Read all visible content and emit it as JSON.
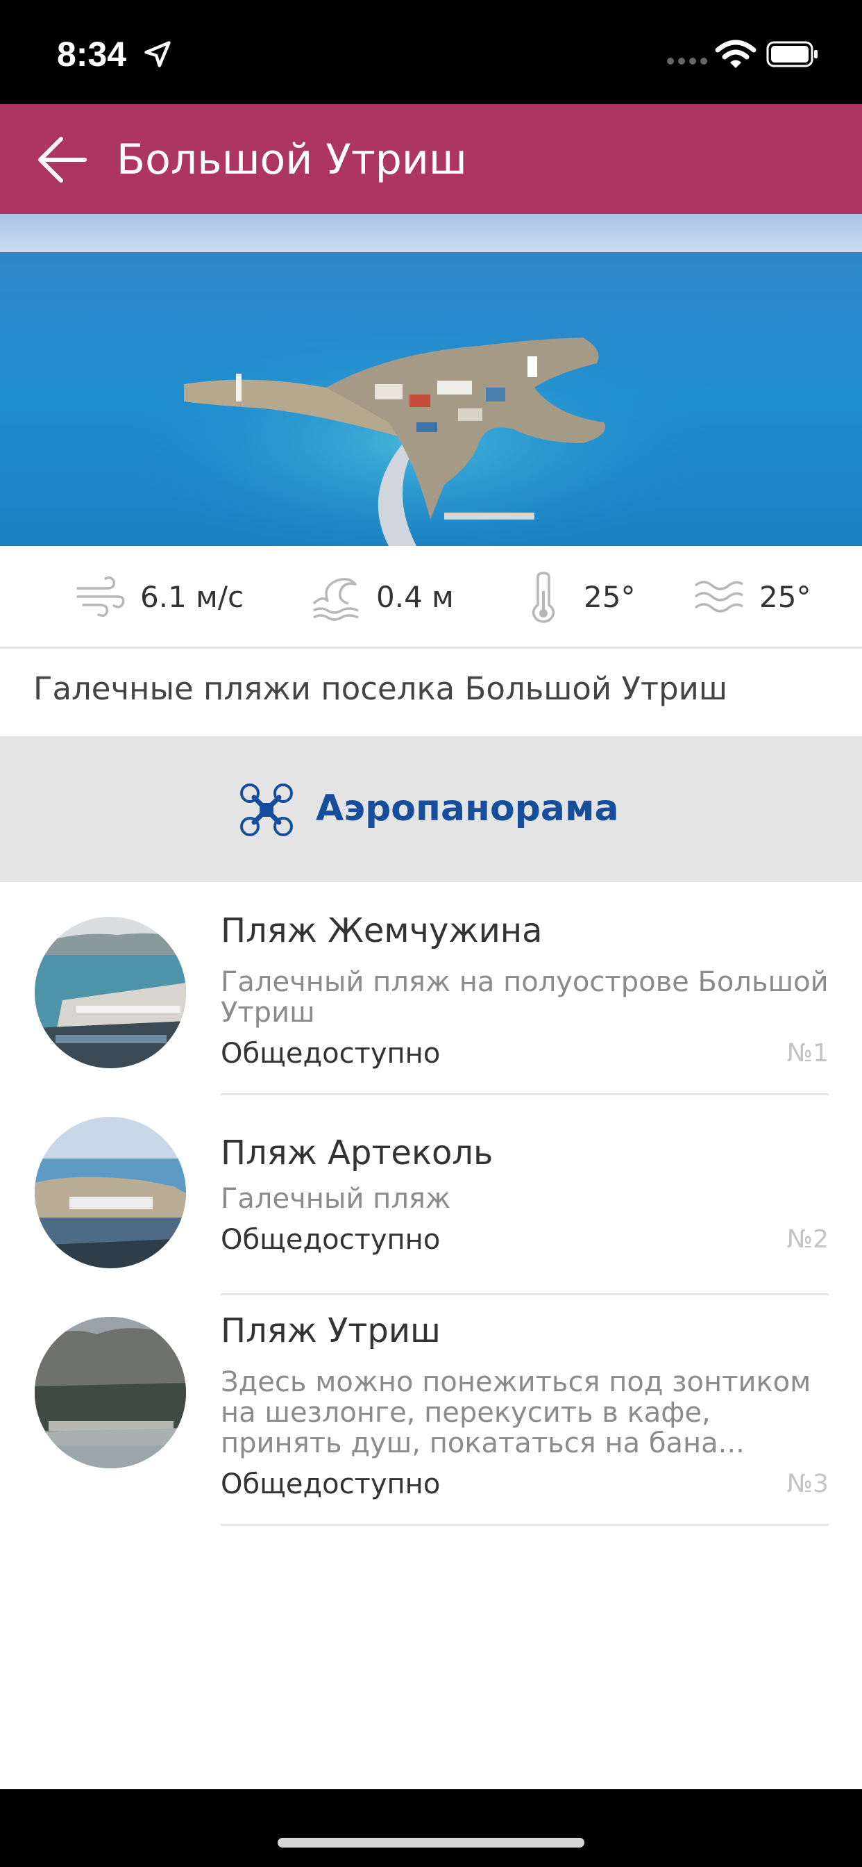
{
  "status": {
    "time": "8:34"
  },
  "header": {
    "title": "Большой Утриш"
  },
  "weather": {
    "wind": "6.1 м/с",
    "wave": "0.4 м",
    "air_temp": "25°",
    "water_temp": "25°"
  },
  "description": "Галечные пляжи поселка Большой Утриш",
  "aero": {
    "label": "Аэропанорама",
    "color": "#164e9b"
  },
  "beaches": [
    {
      "name": "Пляж Жемчужина",
      "desc": "Галечный пляж на полуострове Большой Утриш",
      "access": "Общедоступно",
      "num": "№1"
    },
    {
      "name": "Пляж Артеколь",
      "desc": "Галечный пляж",
      "access": "Общедоступно",
      "num": "№2"
    },
    {
      "name": "Пляж Утриш",
      "desc": "Здесь можно понежиться под зонтиком на шезлонге, перекусить в кафе, принять душ, покататься на бана...",
      "access": "Общедоступно",
      "num": "№3"
    }
  ],
  "colors": {
    "header": "#ad3562",
    "aero_bg": "#e4e4e4"
  },
  "icons": {
    "back": "arrow-left-icon",
    "wind": "wind-icon",
    "wave": "wave-icon",
    "air_temp": "thermometer-icon",
    "water_temp": "water-icon",
    "aero": "drone-icon"
  }
}
